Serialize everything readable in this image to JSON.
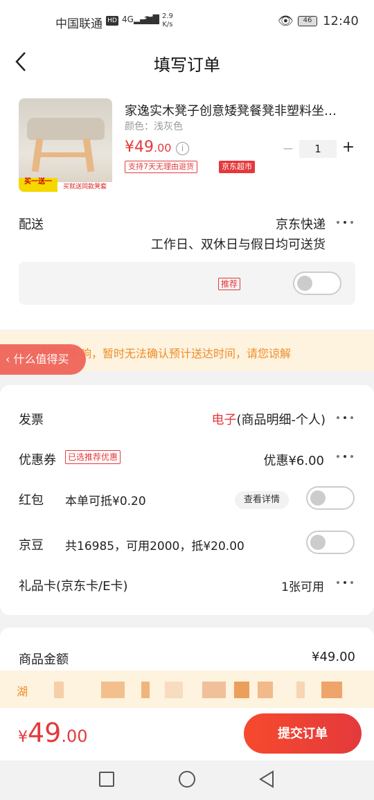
{
  "status_bar": {
    "carrier": "中国联通",
    "hd": "HD",
    "network": "4G",
    "speed": "2.9\nK/s",
    "battery": "46",
    "time": "12:40"
  },
  "nav": {
    "title": "填写订单"
  },
  "product": {
    "title": "家逸实木凳子创意矮凳餐凳非塑料坐…",
    "color": "颜色：浅灰色",
    "price_int": "¥49",
    "price_dec": ".00",
    "quantity": "1",
    "tag_return": "支持7天无理由退货",
    "tag_supermarket": "京东超市",
    "thumb_badge1": "买一送一",
    "thumb_badge2": "买就送同款凳套"
  },
  "delivery": {
    "label": "配送",
    "method": "京东快递",
    "note": "工作日、双休日与假日均可送货",
    "recommend": "推荐"
  },
  "notice": {
    "text": "受交通资源影响，暂时无法确认预计送达时间，请您谅解"
  },
  "floating_tag": {
    "label": "什么值得买"
  },
  "invoice": {
    "label": "发票",
    "type": "电子",
    "detail": "(商品明细-个人)"
  },
  "coupon": {
    "label": "优惠券",
    "tag": "已选推荐优惠",
    "value": "优惠¥6.00"
  },
  "red_packet": {
    "label": "红包",
    "text": "本单可抵¥0.20",
    "detail_btn": "查看详情"
  },
  "jd_beans": {
    "label": "京豆",
    "text": "共16985，可用2000，抵¥20.00"
  },
  "gift_card": {
    "label": "礼品卡(京东卡/E卡)",
    "value": "1张可用"
  },
  "summary": {
    "amount_label": "商品金额",
    "amount_value": "¥49.00"
  },
  "address_bar": {
    "text": "湖"
  },
  "footer": {
    "total_cur": "¥",
    "total_int": "49",
    "total_dec": ".00",
    "submit": "提交订单"
  }
}
